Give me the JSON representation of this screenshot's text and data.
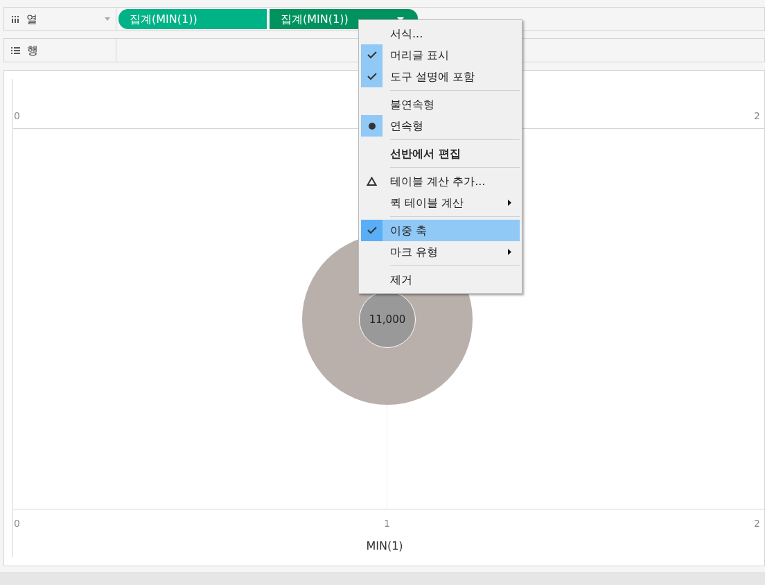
{
  "shelves": [
    {
      "kind": "columns",
      "label": "열",
      "pills": [
        {
          "label": "집계(MIN(1))",
          "selected": false
        },
        {
          "label": "집계(MIN(1))",
          "selected": true
        }
      ]
    },
    {
      "kind": "rows",
      "label": "행"
    }
  ],
  "view": {
    "top_axis_labels": [
      "0",
      "2"
    ],
    "bottom_axis_labels": [
      "0",
      "1",
      "2"
    ],
    "axis_title": "MIN(1)",
    "mark_label": "11,000"
  },
  "menu": {
    "items": [
      {
        "kind": "plain",
        "label": "서식..."
      },
      {
        "kind": "check",
        "label": "머리글 표시",
        "checked": true
      },
      {
        "kind": "check",
        "label": "도구 설명에 포함",
        "checked": true
      },
      {
        "kind": "separator"
      },
      {
        "kind": "radio",
        "label": "불연속형",
        "selected": false
      },
      {
        "kind": "radio",
        "label": "연속형",
        "selected": true
      },
      {
        "kind": "separator"
      },
      {
        "kind": "plain",
        "label": "선반에서 편집",
        "bold": true
      },
      {
        "kind": "separator"
      },
      {
        "kind": "delta",
        "label": "테이블 계산 추가..."
      },
      {
        "kind": "plain",
        "label": "퀵 테이블 계산",
        "submenu": true
      },
      {
        "kind": "separator"
      },
      {
        "kind": "check",
        "label": "이중 축",
        "checked": true,
        "highlighted": true
      },
      {
        "kind": "plain",
        "label": "마크 유형",
        "submenu": true
      },
      {
        "kind": "separator"
      },
      {
        "kind": "plain",
        "label": "제거"
      }
    ]
  }
}
